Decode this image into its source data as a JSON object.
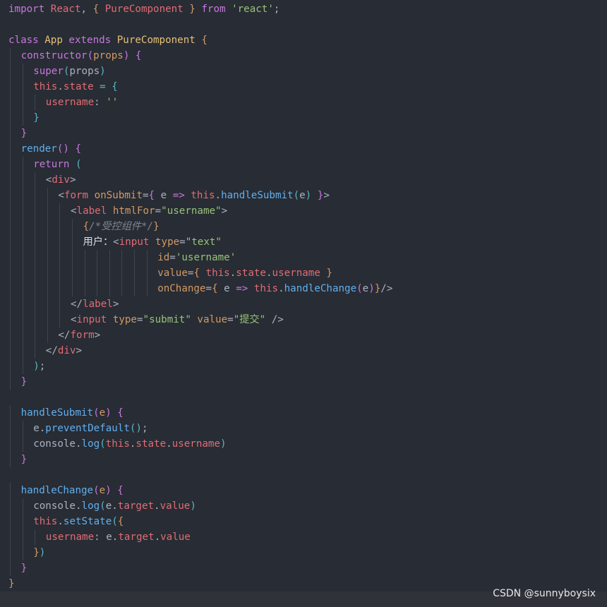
{
  "colors": {
    "background": "#282c34",
    "plain": "#abb2bf",
    "keyword": "#c678dd",
    "class_name": "#e5c07b",
    "string": "#98c379",
    "function": "#61afef",
    "this": "#e06c75",
    "property": "#e06c75",
    "param": "#d19a66",
    "tag": "#e06c75",
    "attr": "#d19a66",
    "punct": "#abb2bf",
    "brace1": "#d19a66",
    "brace2": "#c678dd",
    "brace3": "#56b6c2",
    "comment": "#7f848e",
    "operator": "#56b6c2",
    "white": "#dcdfe4"
  },
  "watermark": "CSDN @sunnyboysix",
  "lines": [
    {
      "indent": 0,
      "tokens": [
        {
          "t": "import ",
          "c": "keyword"
        },
        {
          "t": "React",
          "c": "this"
        },
        {
          "t": ", ",
          "c": "plain"
        },
        {
          "t": "{ ",
          "c": "brace1"
        },
        {
          "t": "PureComponent",
          "c": "this"
        },
        {
          "t": " }",
          "c": "brace1"
        },
        {
          "t": " from ",
          "c": "keyword"
        },
        {
          "t": "'react'",
          "c": "string"
        },
        {
          "t": ";",
          "c": "plain"
        }
      ]
    },
    {
      "indent": 0,
      "tokens": []
    },
    {
      "indent": 0,
      "tokens": [
        {
          "t": "class ",
          "c": "keyword"
        },
        {
          "t": "App",
          "c": "class_name"
        },
        {
          "t": " extends ",
          "c": "keyword"
        },
        {
          "t": "PureComponent",
          "c": "class_name"
        },
        {
          "t": " {",
          "c": "brace1"
        }
      ]
    },
    {
      "indent": 1,
      "tokens": [
        {
          "t": "constructor",
          "c": "keyword"
        },
        {
          "t": "(",
          "c": "brace2"
        },
        {
          "t": "props",
          "c": "param"
        },
        {
          "t": ")",
          "c": "brace2"
        },
        {
          "t": " {",
          "c": "brace2"
        }
      ]
    },
    {
      "indent": 2,
      "tokens": [
        {
          "t": "super",
          "c": "keyword"
        },
        {
          "t": "(",
          "c": "brace3"
        },
        {
          "t": "props",
          "c": "plain"
        },
        {
          "t": ")",
          "c": "brace3"
        }
      ]
    },
    {
      "indent": 2,
      "tokens": [
        {
          "t": "this",
          "c": "this"
        },
        {
          "t": ".",
          "c": "plain"
        },
        {
          "t": "state",
          "c": "property"
        },
        {
          "t": " = ",
          "c": "operator"
        },
        {
          "t": "{",
          "c": "brace3"
        }
      ]
    },
    {
      "indent": 3,
      "tokens": [
        {
          "t": "username",
          "c": "property"
        },
        {
          "t": ": ",
          "c": "plain"
        },
        {
          "t": "''",
          "c": "string"
        }
      ]
    },
    {
      "indent": 2,
      "tokens": [
        {
          "t": "}",
          "c": "brace3"
        }
      ]
    },
    {
      "indent": 1,
      "tokens": [
        {
          "t": "}",
          "c": "brace2"
        }
      ]
    },
    {
      "indent": 1,
      "tokens": [
        {
          "t": "render",
          "c": "function"
        },
        {
          "t": "()",
          "c": "brace2"
        },
        {
          "t": " {",
          "c": "brace2"
        }
      ]
    },
    {
      "indent": 2,
      "tokens": [
        {
          "t": "return",
          "c": "keyword"
        },
        {
          "t": " (",
          "c": "brace3"
        }
      ]
    },
    {
      "indent": 3,
      "tokens": [
        {
          "t": "<",
          "c": "punct"
        },
        {
          "t": "div",
          "c": "tag"
        },
        {
          "t": ">",
          "c": "punct"
        }
      ]
    },
    {
      "indent": 4,
      "tokens": [
        {
          "t": "<",
          "c": "punct"
        },
        {
          "t": "form",
          "c": "tag"
        },
        {
          "t": " ",
          "c": "plain"
        },
        {
          "t": "onSubmit",
          "c": "attr"
        },
        {
          "t": "=",
          "c": "plain"
        },
        {
          "t": "{",
          "c": "brace2"
        },
        {
          "t": " e ",
          "c": "plain"
        },
        {
          "t": "=>",
          "c": "keyword"
        },
        {
          "t": " ",
          "c": "plain"
        },
        {
          "t": "this",
          "c": "this"
        },
        {
          "t": ".",
          "c": "plain"
        },
        {
          "t": "handleSubmit",
          "c": "function"
        },
        {
          "t": "(",
          "c": "brace3"
        },
        {
          "t": "e",
          "c": "plain"
        },
        {
          "t": ")",
          "c": "brace3"
        },
        {
          "t": " }",
          "c": "brace2"
        },
        {
          "t": ">",
          "c": "punct"
        }
      ]
    },
    {
      "indent": 5,
      "tokens": [
        {
          "t": "<",
          "c": "punct"
        },
        {
          "t": "label",
          "c": "tag"
        },
        {
          "t": " ",
          "c": "plain"
        },
        {
          "t": "htmlFor",
          "c": "attr"
        },
        {
          "t": "=",
          "c": "plain"
        },
        {
          "t": "\"username\"",
          "c": "string"
        },
        {
          "t": ">",
          "c": "punct"
        }
      ]
    },
    {
      "indent": 6,
      "tokens": [
        {
          "t": "{",
          "c": "brace1"
        },
        {
          "t": "/*受控组件*/",
          "c": "comment"
        },
        {
          "t": "}",
          "c": "brace1"
        }
      ]
    },
    {
      "indent": 6,
      "tokens": [
        {
          "t": "用户：",
          "c": "white"
        },
        {
          "t": "<",
          "c": "punct"
        },
        {
          "t": "input",
          "c": "tag"
        },
        {
          "t": " ",
          "c": "plain"
        },
        {
          "t": "type",
          "c": "attr"
        },
        {
          "t": "=",
          "c": "plain"
        },
        {
          "t": "\"text\"",
          "c": "string"
        }
      ]
    },
    {
      "indent": 12,
      "tokens": [
        {
          "t": "id",
          "c": "attr"
        },
        {
          "t": "=",
          "c": "plain"
        },
        {
          "t": "'username'",
          "c": "string"
        }
      ]
    },
    {
      "indent": 12,
      "tokens": [
        {
          "t": "value",
          "c": "attr"
        },
        {
          "t": "=",
          "c": "plain"
        },
        {
          "t": "{",
          "c": "brace1"
        },
        {
          "t": " ",
          "c": "plain"
        },
        {
          "t": "this",
          "c": "this"
        },
        {
          "t": ".",
          "c": "plain"
        },
        {
          "t": "state",
          "c": "property"
        },
        {
          "t": ".",
          "c": "plain"
        },
        {
          "t": "username",
          "c": "property"
        },
        {
          "t": " }",
          "c": "brace1"
        }
      ]
    },
    {
      "indent": 12,
      "tokens": [
        {
          "t": "onChange",
          "c": "attr"
        },
        {
          "t": "=",
          "c": "plain"
        },
        {
          "t": "{",
          "c": "brace1"
        },
        {
          "t": " e ",
          "c": "plain"
        },
        {
          "t": "=>",
          "c": "keyword"
        },
        {
          "t": " ",
          "c": "plain"
        },
        {
          "t": "this",
          "c": "this"
        },
        {
          "t": ".",
          "c": "plain"
        },
        {
          "t": "handleChange",
          "c": "function"
        },
        {
          "t": "(",
          "c": "brace2"
        },
        {
          "t": "e",
          "c": "plain"
        },
        {
          "t": ")",
          "c": "brace2"
        },
        {
          "t": "}",
          "c": "brace1"
        },
        {
          "t": "/>",
          "c": "punct"
        }
      ]
    },
    {
      "indent": 5,
      "tokens": [
        {
          "t": "</",
          "c": "punct"
        },
        {
          "t": "label",
          "c": "tag"
        },
        {
          "t": ">",
          "c": "punct"
        }
      ]
    },
    {
      "indent": 5,
      "tokens": [
        {
          "t": "<",
          "c": "punct"
        },
        {
          "t": "input",
          "c": "tag"
        },
        {
          "t": " ",
          "c": "plain"
        },
        {
          "t": "type",
          "c": "attr"
        },
        {
          "t": "=",
          "c": "plain"
        },
        {
          "t": "\"submit\"",
          "c": "string"
        },
        {
          "t": " ",
          "c": "plain"
        },
        {
          "t": "value",
          "c": "attr"
        },
        {
          "t": "=",
          "c": "plain"
        },
        {
          "t": "\"提交\"",
          "c": "string"
        },
        {
          "t": " />",
          "c": "punct"
        }
      ]
    },
    {
      "indent": 4,
      "tokens": [
        {
          "t": "</",
          "c": "punct"
        },
        {
          "t": "form",
          "c": "tag"
        },
        {
          "t": ">",
          "c": "punct"
        }
      ]
    },
    {
      "indent": 3,
      "tokens": [
        {
          "t": "</",
          "c": "punct"
        },
        {
          "t": "div",
          "c": "tag"
        },
        {
          "t": ">",
          "c": "punct"
        }
      ]
    },
    {
      "indent": 2,
      "tokens": [
        {
          "t": ")",
          "c": "brace3"
        },
        {
          "t": ";",
          "c": "plain"
        }
      ]
    },
    {
      "indent": 1,
      "tokens": [
        {
          "t": "}",
          "c": "brace2"
        }
      ]
    },
    {
      "indent": 0,
      "tokens": []
    },
    {
      "indent": 1,
      "tokens": [
        {
          "t": "handleSubmit",
          "c": "function"
        },
        {
          "t": "(",
          "c": "brace2"
        },
        {
          "t": "e",
          "c": "param"
        },
        {
          "t": ")",
          "c": "brace2"
        },
        {
          "t": " {",
          "c": "brace2"
        }
      ]
    },
    {
      "indent": 2,
      "tokens": [
        {
          "t": "e",
          "c": "plain"
        },
        {
          "t": ".",
          "c": "plain"
        },
        {
          "t": "preventDefault",
          "c": "function"
        },
        {
          "t": "()",
          "c": "brace3"
        },
        {
          "t": ";",
          "c": "plain"
        }
      ]
    },
    {
      "indent": 2,
      "tokens": [
        {
          "t": "console",
          "c": "plain"
        },
        {
          "t": ".",
          "c": "plain"
        },
        {
          "t": "log",
          "c": "function"
        },
        {
          "t": "(",
          "c": "brace3"
        },
        {
          "t": "this",
          "c": "this"
        },
        {
          "t": ".",
          "c": "plain"
        },
        {
          "t": "state",
          "c": "property"
        },
        {
          "t": ".",
          "c": "plain"
        },
        {
          "t": "username",
          "c": "property"
        },
        {
          "t": ")",
          "c": "brace3"
        }
      ]
    },
    {
      "indent": 1,
      "tokens": [
        {
          "t": "}",
          "c": "brace2"
        }
      ]
    },
    {
      "indent": 0,
      "tokens": []
    },
    {
      "indent": 1,
      "tokens": [
        {
          "t": "handleChange",
          "c": "function"
        },
        {
          "t": "(",
          "c": "brace2"
        },
        {
          "t": "e",
          "c": "param"
        },
        {
          "t": ")",
          "c": "brace2"
        },
        {
          "t": " {",
          "c": "brace2"
        }
      ]
    },
    {
      "indent": 2,
      "tokens": [
        {
          "t": "console",
          "c": "plain"
        },
        {
          "t": ".",
          "c": "plain"
        },
        {
          "t": "log",
          "c": "function"
        },
        {
          "t": "(",
          "c": "brace3"
        },
        {
          "t": "e",
          "c": "plain"
        },
        {
          "t": ".",
          "c": "plain"
        },
        {
          "t": "target",
          "c": "property"
        },
        {
          "t": ".",
          "c": "plain"
        },
        {
          "t": "value",
          "c": "property"
        },
        {
          "t": ")",
          "c": "brace3"
        }
      ]
    },
    {
      "indent": 2,
      "tokens": [
        {
          "t": "this",
          "c": "this"
        },
        {
          "t": ".",
          "c": "plain"
        },
        {
          "t": "setState",
          "c": "function"
        },
        {
          "t": "(",
          "c": "brace3"
        },
        {
          "t": "{",
          "c": "brace1"
        }
      ]
    },
    {
      "indent": 3,
      "tokens": [
        {
          "t": "username",
          "c": "property"
        },
        {
          "t": ": ",
          "c": "plain"
        },
        {
          "t": "e",
          "c": "plain"
        },
        {
          "t": ".",
          "c": "plain"
        },
        {
          "t": "target",
          "c": "property"
        },
        {
          "t": ".",
          "c": "plain"
        },
        {
          "t": "value",
          "c": "property"
        }
      ]
    },
    {
      "indent": 2,
      "tokens": [
        {
          "t": "}",
          "c": "brace1"
        },
        {
          "t": ")",
          "c": "brace3"
        }
      ]
    },
    {
      "indent": 1,
      "tokens": [
        {
          "t": "}",
          "c": "brace2"
        }
      ]
    },
    {
      "indent": 0,
      "tokens": [
        {
          "t": "}",
          "c": "brace1"
        }
      ]
    }
  ]
}
